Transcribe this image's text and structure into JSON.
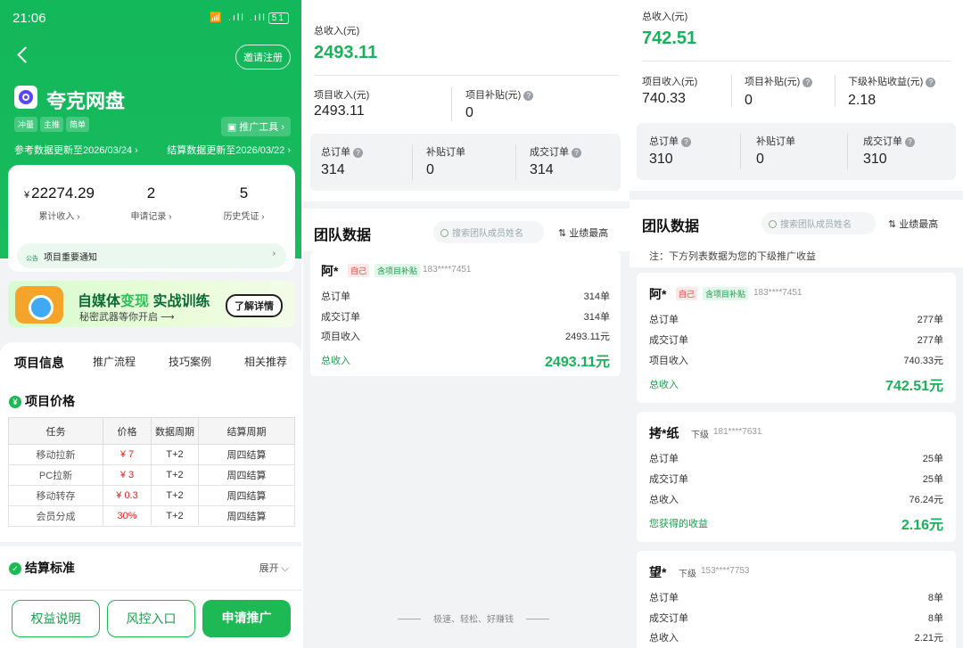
{
  "p1": {
    "time": "21:06",
    "status_icons": "📶 .ıll .ıll",
    "battery": "51",
    "invite": "邀请注册",
    "app_name": "夸克网盘",
    "tags": [
      "冲量",
      "主推",
      "简单"
    ],
    "promo_tool": "推广工具 ›",
    "ref_update": "参考数据更新至2026/03/24 ›",
    "settle_update": "结算数据更新至2026/03/22 ›",
    "stats": [
      {
        "value": "22274.29",
        "prefix": "¥",
        "label": "累计收入 ›"
      },
      {
        "value": "2",
        "label": "申请记录 ›"
      },
      {
        "value": "5",
        "label": "历史凭证 ›"
      }
    ],
    "notice_badge": "公告",
    "notice": "项目重要通知",
    "banner": {
      "t1a": "自媒体",
      "t1b": "变现",
      "t1c": " 实战训练",
      "t2": "秘密武器等你开启 ⟶",
      "btn": "了解详情"
    },
    "tabs": [
      "项目信息",
      "推广流程",
      "技巧案例",
      "相关推荐"
    ],
    "price_title": "项目价格",
    "price_icon": "¥",
    "table_headers": [
      "任务",
      "价格",
      "数据周期",
      "结算周期"
    ],
    "table_rows": [
      [
        "移动拉新",
        "¥ 7",
        "T+2",
        "周四结算"
      ],
      [
        "PC拉新",
        "¥ 3",
        "T+2",
        "周四结算"
      ],
      [
        "移动转存",
        "¥ 0.3",
        "T+2",
        "周四结算"
      ],
      [
        "会员分成",
        "30%",
        "T+2",
        "周四结算"
      ]
    ],
    "settle_title": "结算标准",
    "settle_icon": "✓",
    "expand": "展开 ⌵",
    "buttons": [
      "权益说明",
      "风控入口",
      "申请推广"
    ]
  },
  "p2": {
    "total_label": "总收入(元)",
    "total": "2493.11",
    "proj_income_label": "项目收入(元)",
    "proj_income": "2493.11",
    "subsidy_label": "项目补贴(元)",
    "subsidy": "0",
    "orders": [
      {
        "label": "总订单",
        "value": "314",
        "help": true
      },
      {
        "label": "补贴订单",
        "value": "0",
        "help": false
      },
      {
        "label": "成交订单",
        "value": "314",
        "help": true
      }
    ],
    "team_title": "团队数据",
    "search_placeholder": "搜索团队成员姓名",
    "sort": "⇅ 业绩最高",
    "member": {
      "name": "阿*",
      "tag1": "自己",
      "tag2": "含项目补贴",
      "phone": "183****7451",
      "rows": [
        {
          "label": "总订单",
          "value": "314单"
        },
        {
          "label": "成交订单",
          "value": "314单"
        },
        {
          "label": "项目收入",
          "value": "2493.11元"
        }
      ],
      "total_label": "总收入",
      "total_value": "2493.11元"
    },
    "footer": "极速、轻松、好赚钱"
  },
  "p3": {
    "total_label": "总收入(元)",
    "total": "742.51",
    "proj_income_label": "项目收入(元)",
    "proj_income": "740.33",
    "subsidy_label": "项目补贴(元)",
    "subsidy": "0",
    "sub_income_label": "下级补贴收益(元)",
    "sub_income": "2.18",
    "orders": [
      {
        "label": "总订单",
        "value": "310",
        "help": true
      },
      {
        "label": "补贴订单",
        "value": "0",
        "help": false
      },
      {
        "label": "成交订单",
        "value": "310",
        "help": true
      }
    ],
    "team_title": "团队数据",
    "search_placeholder": "搜索团队成员姓名",
    "sort": "⇅ 业绩最高",
    "note": "注：下方列表数据为您的下级推广收益",
    "members": [
      {
        "name": "阿*",
        "tag1": "自己",
        "tag2": "含项目补贴",
        "phone": "183****7451",
        "rows": [
          {
            "label": "总订单",
            "value": "277单"
          },
          {
            "label": "成交订单",
            "value": "277单"
          },
          {
            "label": "项目收入",
            "value": "740.33元"
          }
        ],
        "total_label": "总收入",
        "total_value": "742.51元"
      },
      {
        "name": "拷*纸",
        "level": "下级",
        "phone": "181****7631",
        "rows": [
          {
            "label": "总订单",
            "value": "25单"
          },
          {
            "label": "成交订单",
            "value": "25单"
          },
          {
            "label": "总收入",
            "value": "76.24元"
          }
        ],
        "total_label": "您获得的收益",
        "total_value": "2.16元"
      },
      {
        "name": "望*",
        "level": "下级",
        "phone": "153****7753",
        "rows": [
          {
            "label": "总订单",
            "value": "8单"
          },
          {
            "label": "成交订单",
            "value": "8单"
          },
          {
            "label": "总收入",
            "value": "2.21元"
          }
        ]
      }
    ]
  },
  "colors": {
    "brand_green": "#1db954",
    "price_red": "#e02020"
  }
}
